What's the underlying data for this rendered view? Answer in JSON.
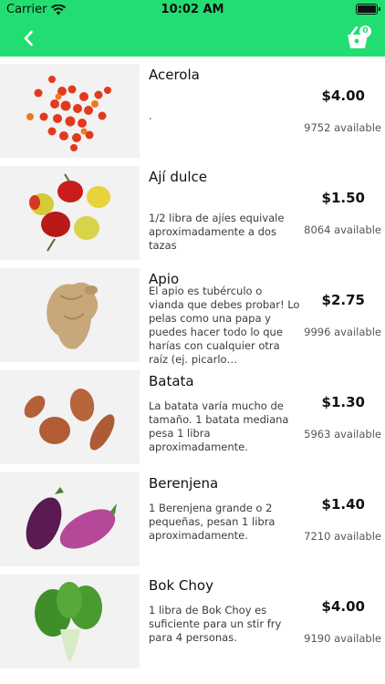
{
  "status_bar": {
    "carrier": "Carrier",
    "time": "10:02 AM"
  },
  "nav": {
    "back_icon": "chevron-left-icon",
    "cart_icon": "shopping-basket-icon",
    "cart_count": "0",
    "accent_color": "#22de72"
  },
  "products": [
    {
      "name": "Acerola",
      "description": ".",
      "price": "$4.00",
      "available": "9752 available",
      "image": "acerola-photo"
    },
    {
      "name": "Ají dulce",
      "description": "1/2 libra de ajíes equivale aproximadamente a dos tazas",
      "price": "$1.50",
      "available": "8064 available",
      "image": "aji-dulce-photo"
    },
    {
      "name": "Apio",
      "description": "El apio es tubérculo o vianda que debes probar! Lo pelas como una papa y puedes hacer todo lo que harías con cualquier otra raíz (ej. picarlo…",
      "price": "$2.75",
      "available": "9996 available",
      "image": "apio-photo"
    },
    {
      "name": "Batata",
      "description": "La batata varía mucho de tamaño. 1 batata mediana pesa 1 libra aproximadamente.",
      "price": "$1.30",
      "available": "5963 available",
      "image": "batata-photo"
    },
    {
      "name": "Berenjena",
      "description": "1 Berenjena grande o 2 pequeñas, pesan 1 libra aproximadamente.",
      "price": "$1.40",
      "available": "7210 available",
      "image": "berenjena-photo"
    },
    {
      "name": "Bok Choy",
      "description": "1 libra de Bok Choy es suficiente para un stir fry para 4 personas.",
      "price": "$4.00",
      "available": "9190 available",
      "image": "bok-choy-photo"
    }
  ]
}
